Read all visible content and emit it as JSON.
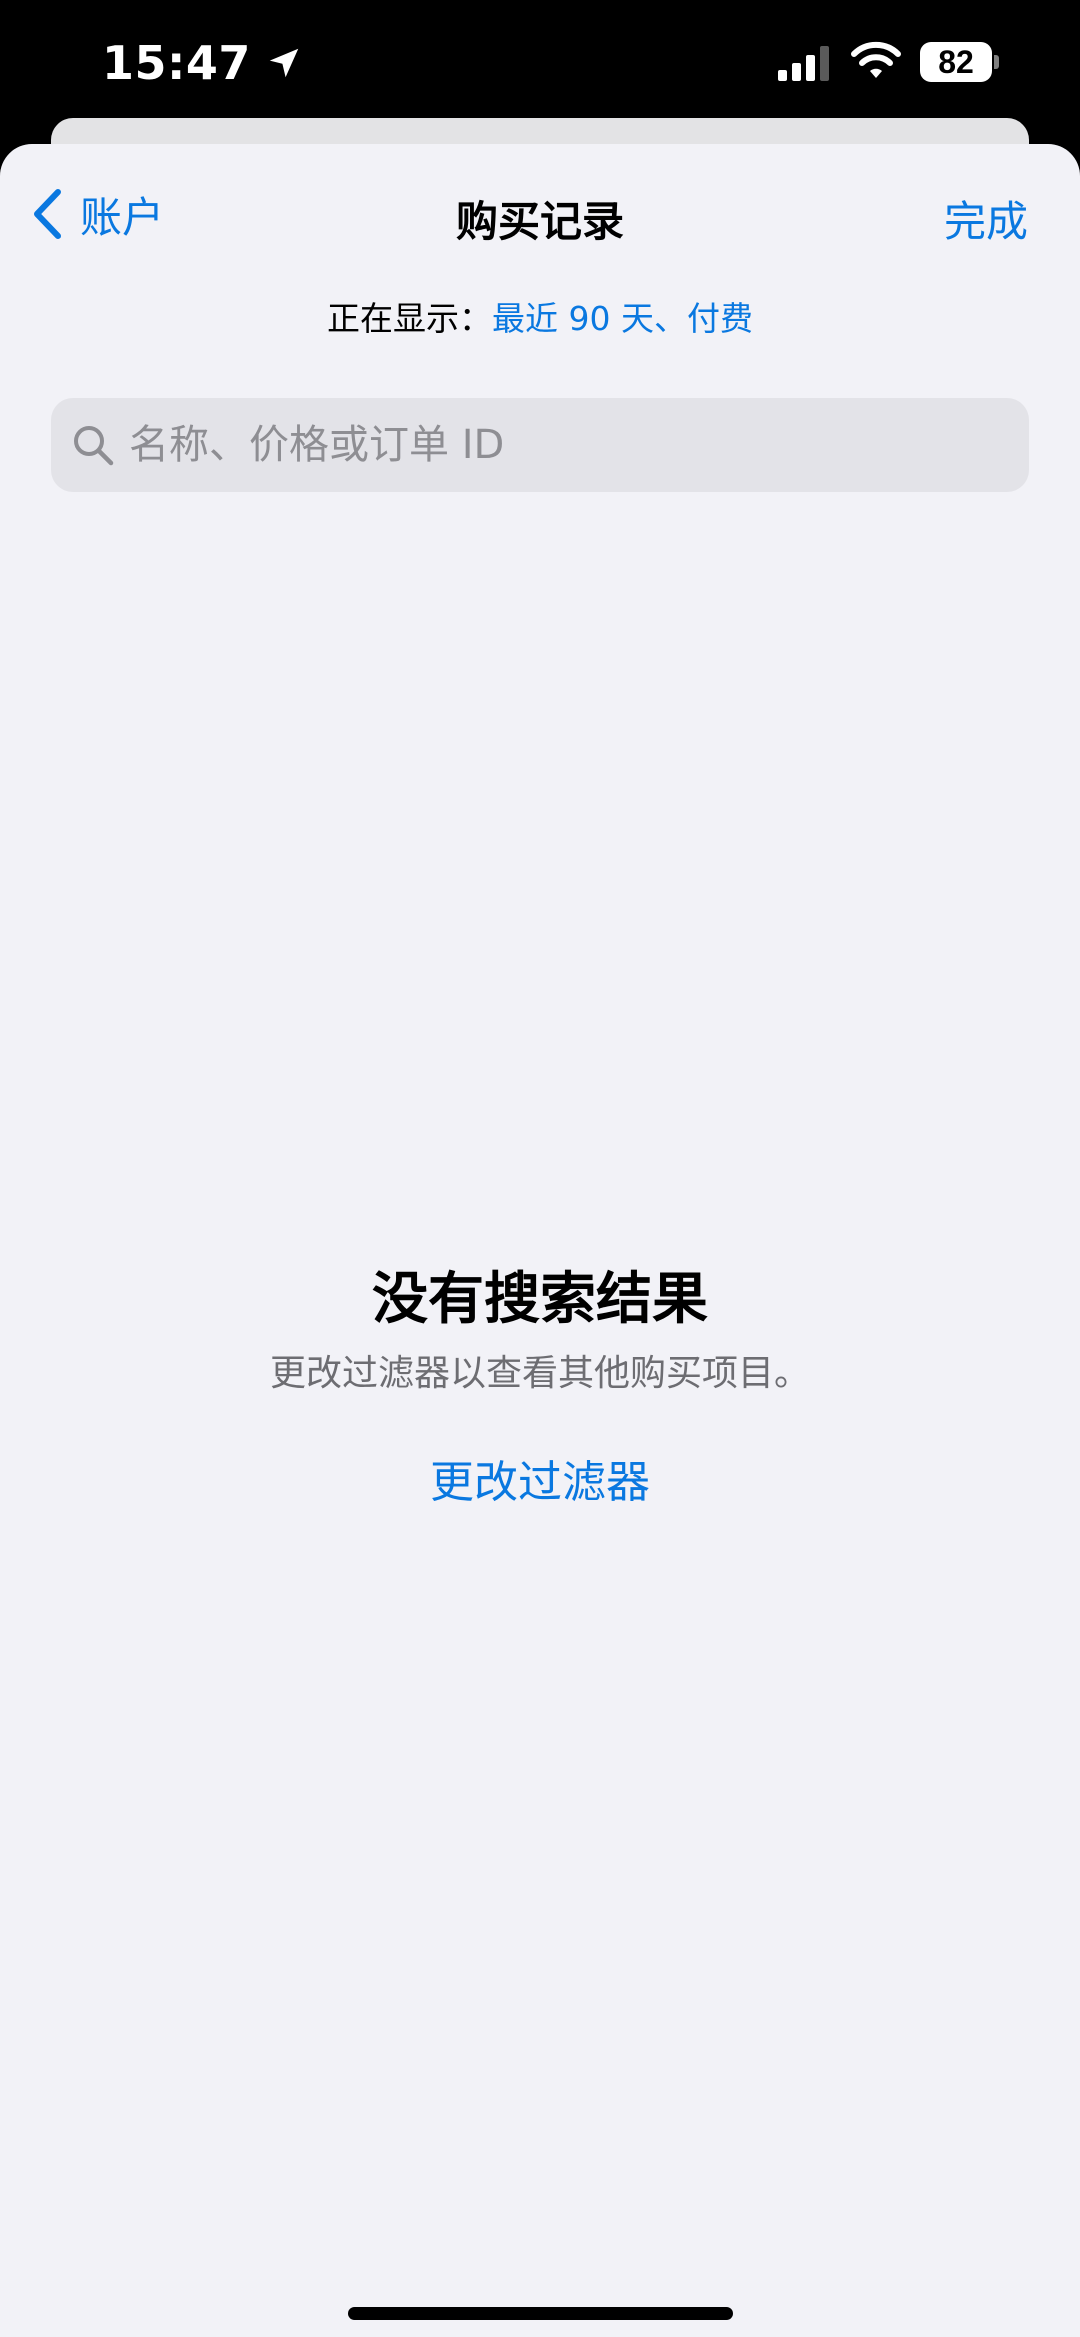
{
  "status_bar": {
    "time": "15:47",
    "battery": "82"
  },
  "nav": {
    "back_label": "账户",
    "title": "购买记录",
    "done_label": "完成"
  },
  "filter": {
    "prefix": "正在显示：",
    "value": "最近 90 天、付费"
  },
  "search": {
    "placeholder": "名称、价格或订单 ID",
    "value": ""
  },
  "empty_state": {
    "title": "没有搜索结果",
    "subtitle": "更改过滤器以查看其他购买项目。",
    "action_label": "更改过滤器"
  },
  "colors": {
    "accent": "#0a78e0",
    "background": "#f2f2f7"
  },
  "icons": [
    "location-arrow-icon",
    "cellular-signal-icon",
    "wifi-icon",
    "battery-icon",
    "chevron-left-icon",
    "search-icon"
  ]
}
